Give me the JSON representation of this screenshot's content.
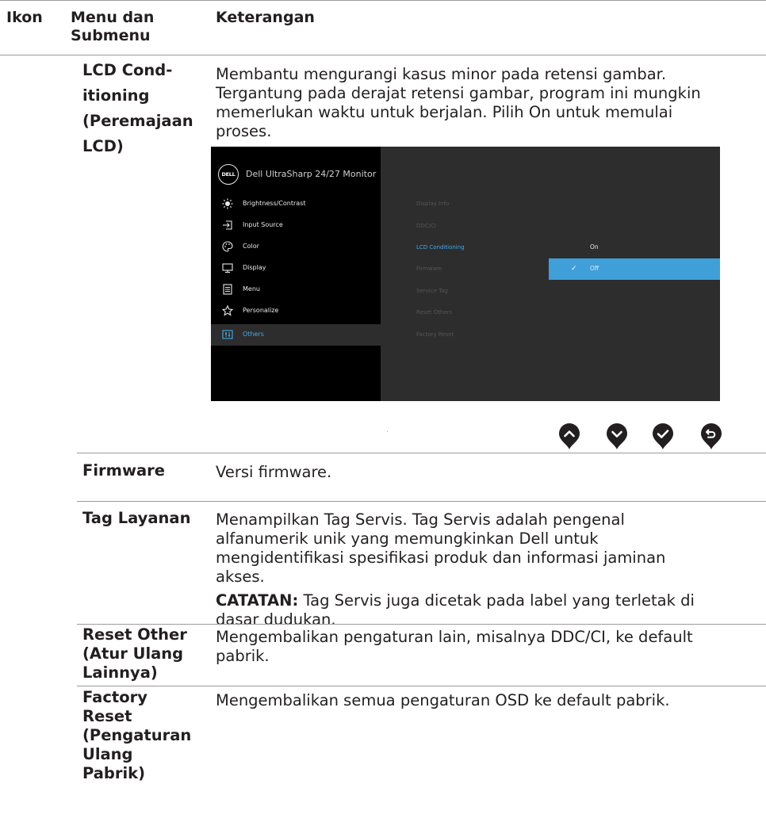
{
  "table": {
    "headers": {
      "icon": "Ikon",
      "menu_line1": "Menu dan",
      "menu_line2": "Submenu",
      "desc": "Keterangan"
    },
    "rows": [
      {
        "sub": [
          "LCD Cond-",
          "itioning",
          "(Peremajaan",
          "LCD)"
        ],
        "desc": [
          "Membantu mengurangi kasus minor pada retensi gambar.",
          "Tergantung pada derajat retensi gambar, program ini mungkin",
          "memerlukan waktu untuk berjalan. Pilih On untuk memulai",
          "proses."
        ]
      },
      {
        "sub": [
          "Firmware"
        ],
        "desc": [
          "Versi firmware."
        ]
      },
      {
        "sub": [
          "Tag Layanan"
        ],
        "desc": [
          "Menampilkan Tag Servis. Tag Servis adalah pengenal",
          "alfanumerik unik yang memungkinkan Dell untuk",
          "mengidentifikasi spesifikasi produk dan informasi jaminan",
          "akses."
        ],
        "note_label": "CATATAN:",
        "note_line1": " Tag Servis juga dicetak pada label yang terletak di",
        "note_line2": "dasar dudukan."
      },
      {
        "sub": [
          "Reset Other",
          "(Atur Ulang",
          "Lainnya)"
        ],
        "desc": [
          "Mengembalikan pengaturan lain, misalnya DDC/CI, ke default",
          "pabrik."
        ]
      },
      {
        "sub": [
          "Factory",
          "Reset",
          "(Pengaturan",
          "Ulang",
          "Pabrik)"
        ],
        "desc": [
          "Mengembalikan semua pengaturan OSD ke default pabrik."
        ]
      }
    ]
  },
  "osd": {
    "logo": "DELL",
    "title": "Dell UltraSharp 24/27 Monitor",
    "menu": [
      {
        "label": "Brightness/Contrast",
        "icon": "brightness-icon"
      },
      {
        "label": "Input Source",
        "icon": "input-source-icon"
      },
      {
        "label": "Color",
        "icon": "color-palette-icon"
      },
      {
        "label": "Display",
        "icon": "display-icon"
      },
      {
        "label": "Menu",
        "icon": "menu-icon"
      },
      {
        "label": "Personalize",
        "icon": "star-icon"
      },
      {
        "label": "Others",
        "icon": "others-icon"
      }
    ],
    "selected_menu": "Others",
    "submenu": [
      "Display Info",
      "DDC/CI",
      "LCD Conditioning",
      "Firmware",
      "Service Tag",
      "Reset Others",
      "Factory Reset"
    ],
    "selected_submenu": "LCD Conditioning",
    "options": [
      "On",
      "Off"
    ],
    "selected_option": "Off",
    "accent_color": "#43a9e6",
    "highlight_color": "#3f9fd9"
  },
  "buttons": [
    {
      "icon": "up-arrow-icon"
    },
    {
      "icon": "down-arrow-icon"
    },
    {
      "icon": "checkmark-icon"
    },
    {
      "icon": "back-icon"
    }
  ]
}
